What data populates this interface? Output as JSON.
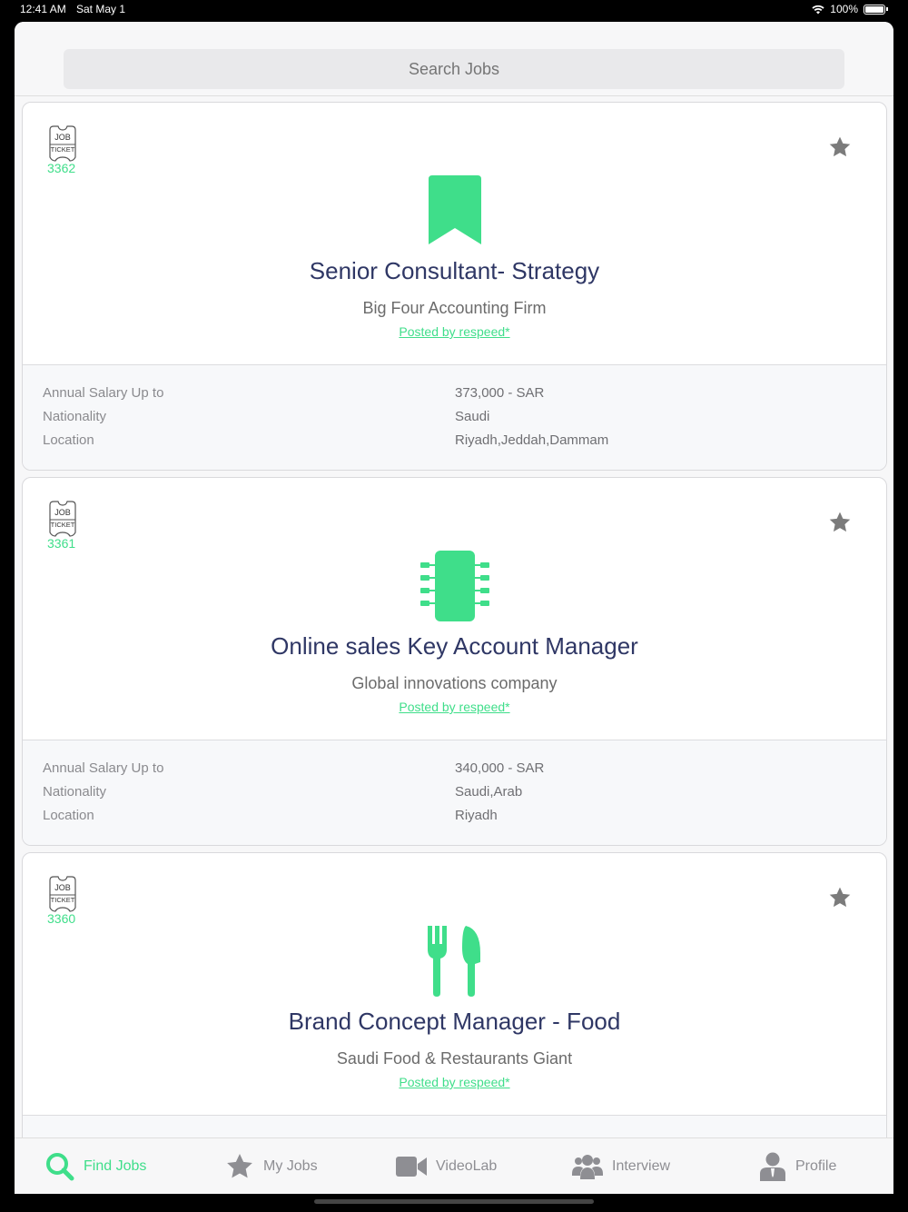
{
  "status": {
    "time": "12:41 AM",
    "date": "Sat May 1",
    "battery": "100%"
  },
  "search": {
    "placeholder": "Search Jobs"
  },
  "jobs": [
    {
      "ticket": "3362",
      "icon": "bookmark-icon",
      "title": "Senior Consultant- Strategy",
      "company": "Big Four Accounting Firm",
      "posted": "Posted by respeed*",
      "labels": {
        "salary": "Annual Salary Up to",
        "nationality": "Nationality",
        "location": "Location"
      },
      "salary": "373,000 - SAR",
      "nationality": "Saudi",
      "location": "Riyadh,Jeddah,Dammam"
    },
    {
      "ticket": "3361",
      "icon": "chip-icon",
      "title": "Online sales Key Account Manager",
      "company": "Global innovations company",
      "posted": "Posted by respeed*",
      "labels": {
        "salary": "Annual Salary Up to",
        "nationality": "Nationality",
        "location": "Location"
      },
      "salary": "340,000 - SAR",
      "nationality": "Saudi,Arab",
      "location": "Riyadh"
    },
    {
      "ticket": "3360",
      "icon": "fork-knife-icon",
      "title": "Brand Concept Manager - Food",
      "company": "Saudi Food & Restaurants Giant",
      "posted": "Posted by respeed*"
    }
  ],
  "ticket_label": {
    "line1": "JOB",
    "line2": "TICKET"
  },
  "tabs": [
    {
      "label": "Find Jobs",
      "icon": "search-icon",
      "active": true
    },
    {
      "label": "My Jobs",
      "icon": "star-icon"
    },
    {
      "label": "VideoLab",
      "icon": "video-camera-icon"
    },
    {
      "label": "Interview",
      "icon": "users-icon"
    },
    {
      "label": "Profile",
      "icon": "user-icon"
    }
  ],
  "colors": {
    "accent": "#3fde8a",
    "title": "#2f3765",
    "icon_gray": "#8e8e93"
  }
}
